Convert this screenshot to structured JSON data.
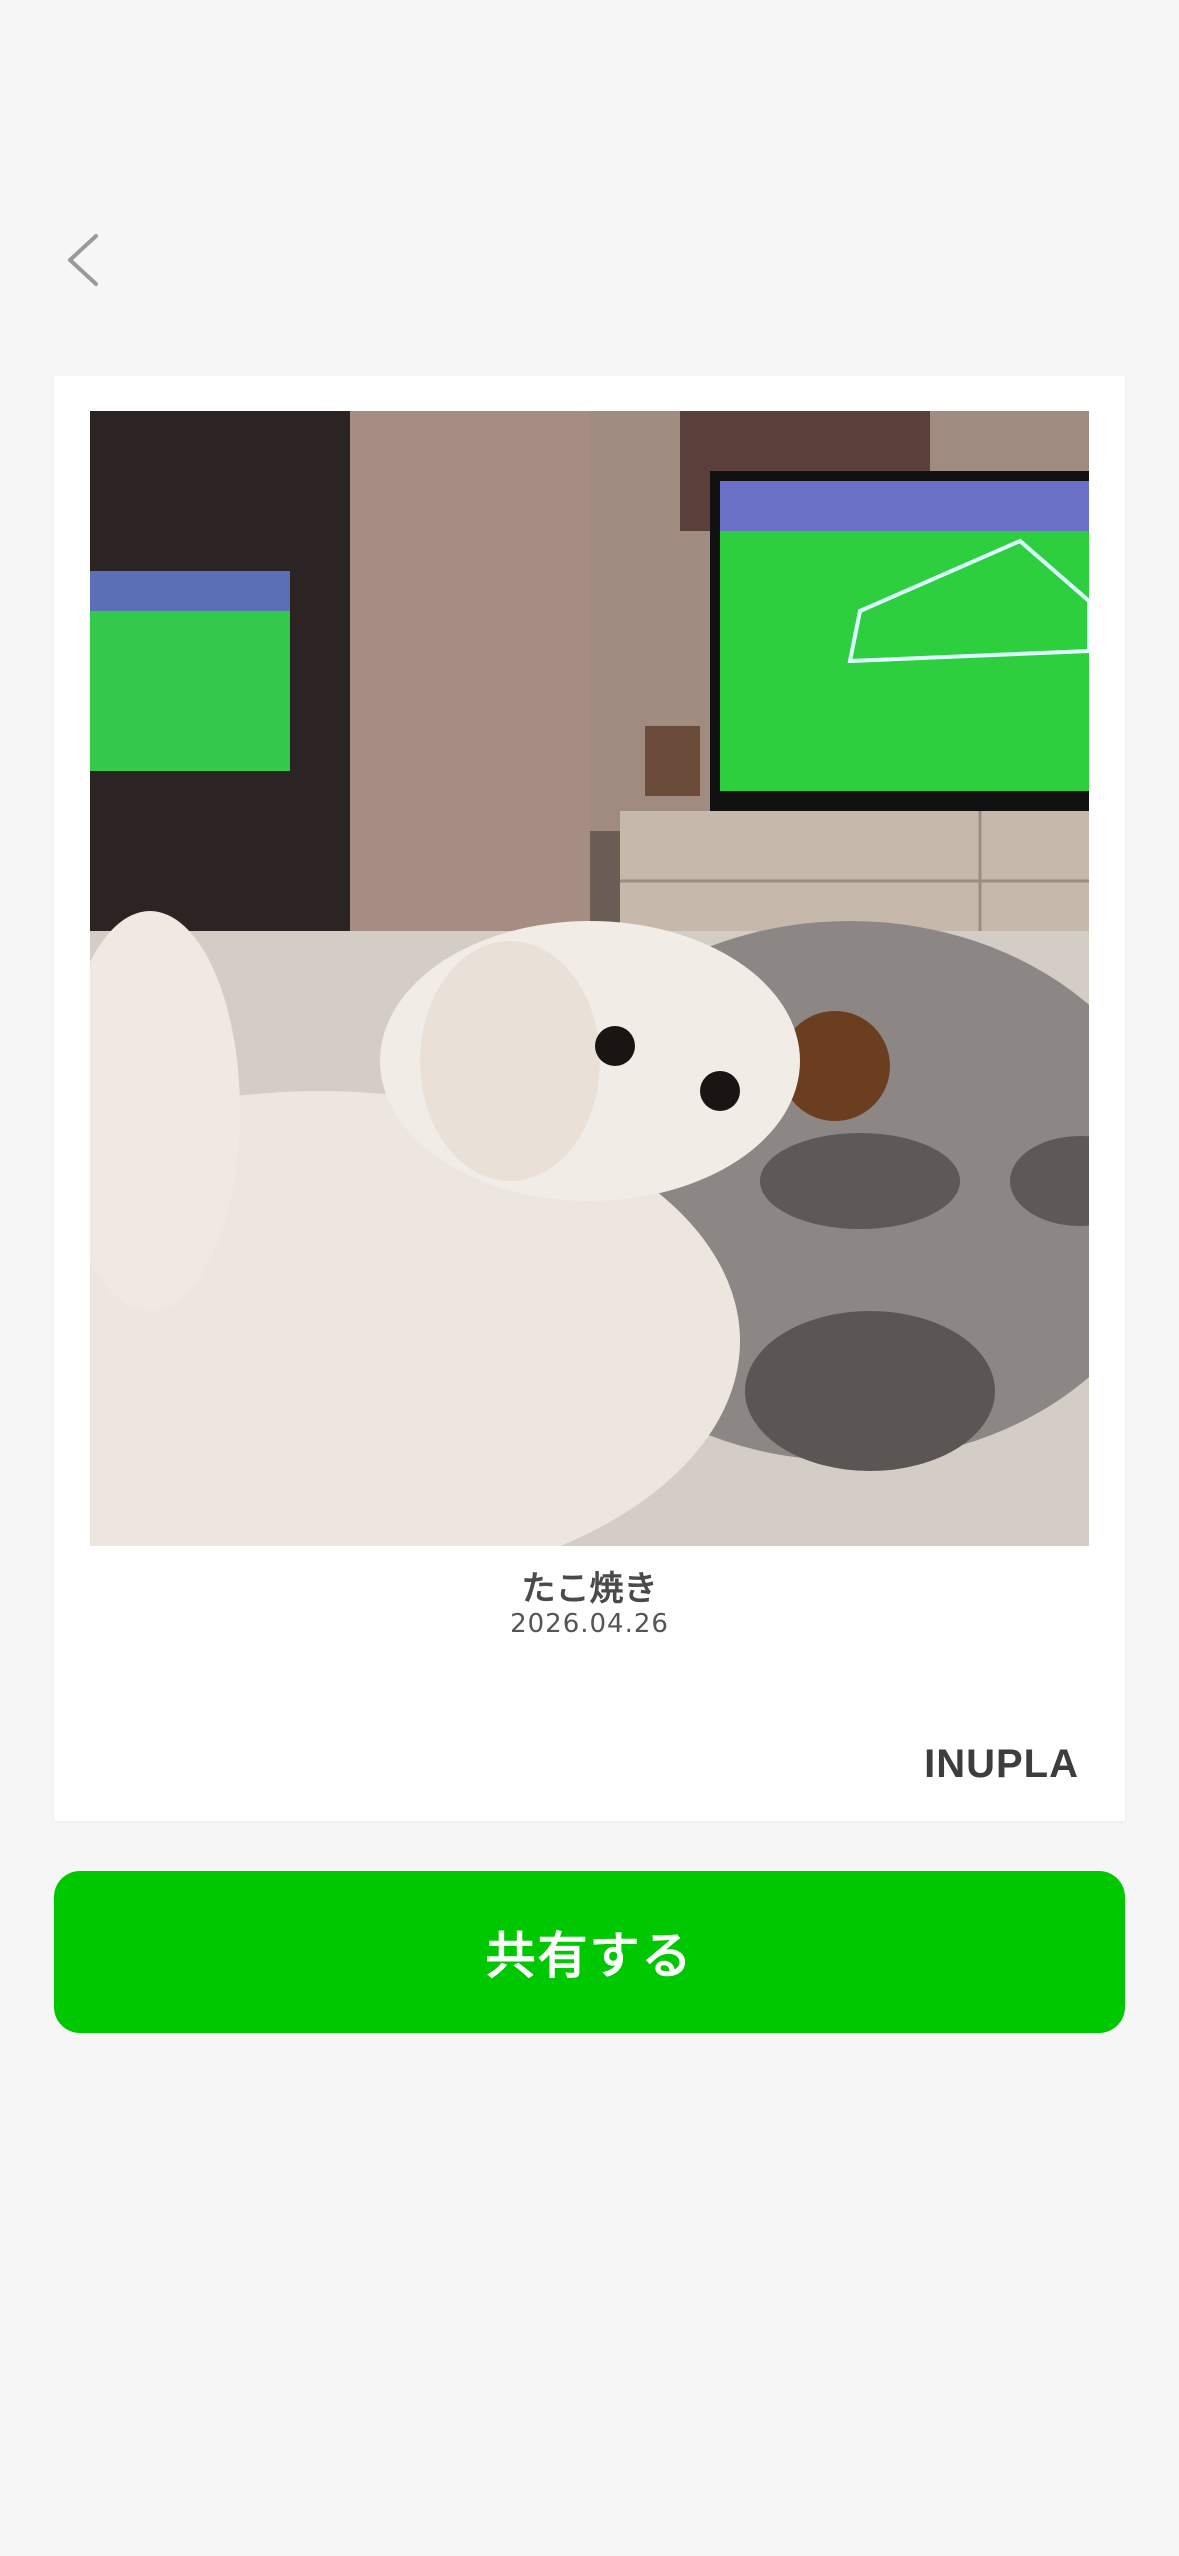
{
  "header": {
    "back_icon": "chevron-left-icon"
  },
  "card": {
    "photo_description_icon": "photo",
    "title": "たこ焼き",
    "date": "2026.04.26",
    "brand": "INUPLA"
  },
  "actions": {
    "share_label": "共有する"
  },
  "colors": {
    "accent": "#00c800",
    "background": "#f6f6f6"
  }
}
